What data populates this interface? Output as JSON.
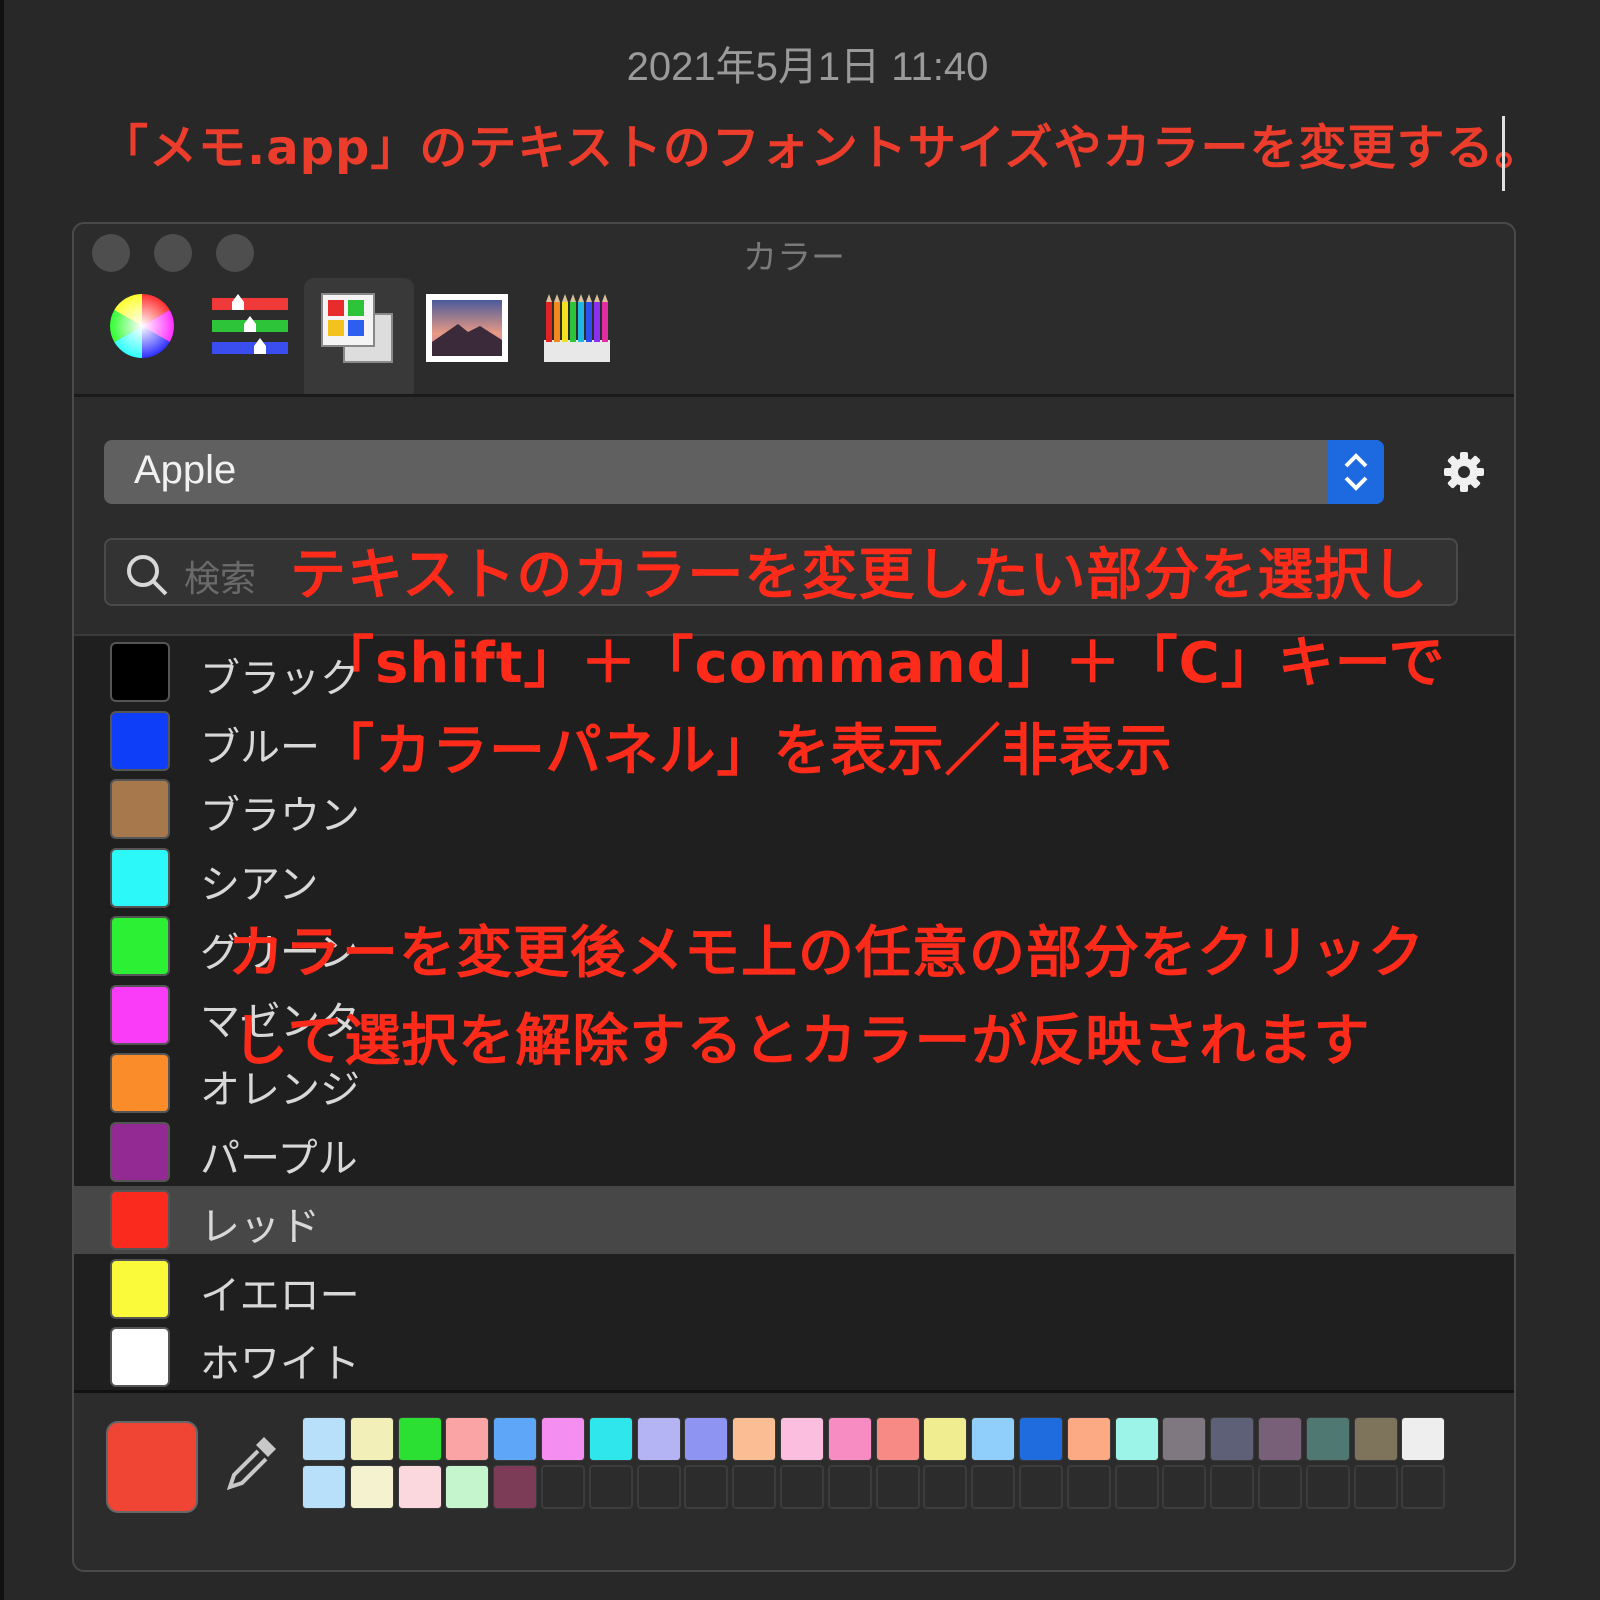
{
  "note": {
    "timestamp": "2021年5月1日 11:40",
    "text": "「メモ.app」のテキストのフォントサイズやカラーを変更する。"
  },
  "panel": {
    "title": "カラー",
    "tabs": [
      {
        "name": "color-wheel-tab"
      },
      {
        "name": "color-sliders-tab"
      },
      {
        "name": "color-palettes-tab",
        "selected": true
      },
      {
        "name": "image-palettes-tab"
      },
      {
        "name": "pencils-tab"
      }
    ],
    "list_select": "Apple",
    "search_placeholder": "検索",
    "colors": [
      {
        "name": "ブラック",
        "hex": "#000000"
      },
      {
        "name": "ブルー",
        "hex": "#0f3ef8"
      },
      {
        "name": "ブラウン",
        "hex": "#a7784c"
      },
      {
        "name": "シアン",
        "hex": "#2cf8fa"
      },
      {
        "name": "グリーン",
        "hex": "#2cf034"
      },
      {
        "name": "マゼンタ",
        "hex": "#fa3cf8"
      },
      {
        "name": "オレンジ",
        "hex": "#fa8c2a"
      },
      {
        "name": "パープル",
        "hex": "#932a93"
      },
      {
        "name": "レッド",
        "hex": "#fa2b1e",
        "selected": true
      },
      {
        "name": "イエロー",
        "hex": "#fafa3a"
      },
      {
        "name": "ホワイト",
        "hex": "#ffffff"
      }
    ],
    "current_color": "#f04534",
    "saved_swatches": {
      "row1": [
        "#b8e0fb",
        "#f2f0b8",
        "#2ce033",
        "#fba4a6",
        "#5da6f8",
        "#f48ef0",
        "#2ee6ec",
        "#b4b4f5",
        "#8e94f2",
        "#fbbe94",
        "#fbbede",
        "#f68cc2",
        "#f88a86",
        "#f0ec90",
        "#90cffb",
        "#1f6cde",
        "#fbaa84",
        "#9cf4e8",
        "#807880",
        "#5e6078",
        "#786078",
        "#507872",
        "#7e745c",
        "#eeeeee"
      ],
      "row2": [
        "#b8e0fb",
        "#f5f2cf",
        "#fbd8de",
        "#c4f5cc",
        "#7c3c58"
      ],
      "row2_empty_count": 19
    }
  },
  "annotations": {
    "line1": "テキストのカラーを変更したい部分を選択し",
    "line2": "「shift」＋「command」＋「C」キーで",
    "line3": "「カラーパネル」を表示／非表示",
    "line4": "カラーを変更後メモ上の任意の部分をクリック",
    "line5": "して選択を解除するとカラーが反映されます"
  }
}
